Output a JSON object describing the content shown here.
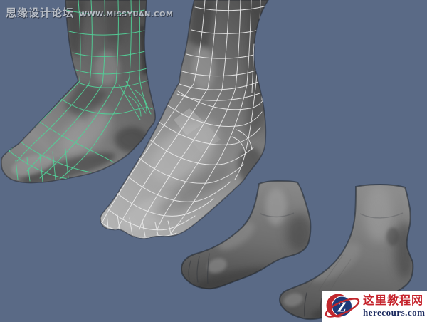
{
  "viewport": {
    "background_color": "#5a6a86"
  },
  "watermark": {
    "forum_name": "思缘设计论坛",
    "forum_url": "WWW.MISSYUAN.COM",
    "text_color": "#b8bdc5"
  },
  "models": {
    "selected_wire_color": "#52cf97",
    "unselected_wire_color": "#ebebeb"
  },
  "logo": {
    "site_name": "这里教程网",
    "site_url": "herecours.com",
    "monogram": "Z",
    "name_color": "#c5222b",
    "url_color": "#17265c",
    "circle_color": "#1e3a78",
    "swoosh_color": "#c1272d",
    "box_color": "#ffffff"
  }
}
